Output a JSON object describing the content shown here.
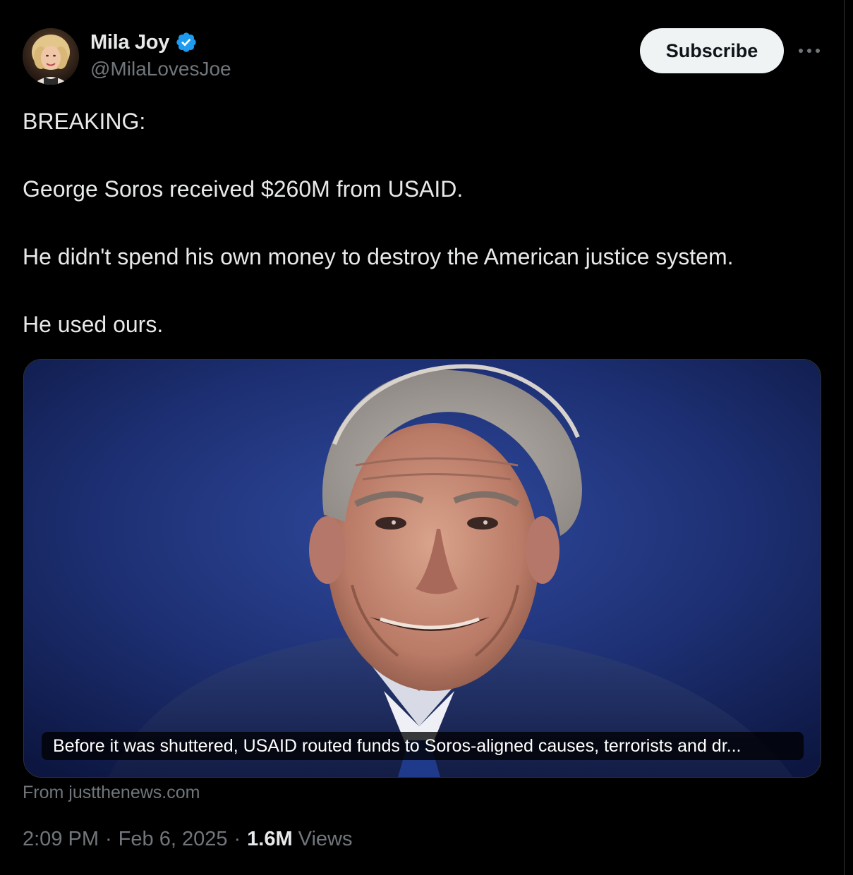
{
  "author": {
    "display_name": "Mila Joy",
    "handle": "@MilaLovesJoe",
    "verified": true
  },
  "actions": {
    "subscribe_label": "Subscribe",
    "more_icon": "more-horizontal-icon"
  },
  "tweet": {
    "paragraphs": [
      "BREAKING:",
      "George Soros received $260M from USAID.",
      "He didn't spend his own money to destroy the American justice system.",
      "He used ours."
    ]
  },
  "card": {
    "caption": "Before it was shuttered, USAID routed funds to Soros-aligned causes, terrorists and dr...",
    "source": "From justthenews.com"
  },
  "meta": {
    "time": "2:09 PM",
    "separator": "·",
    "date": "Feb 6, 2025",
    "views_count": "1.6M",
    "views_label": "Views"
  },
  "colors": {
    "background": "#000000",
    "text_primary": "#e7e9ea",
    "text_secondary": "#71767b",
    "verified_badge": "#1d9bf0",
    "button_bg": "#eff3f4"
  }
}
